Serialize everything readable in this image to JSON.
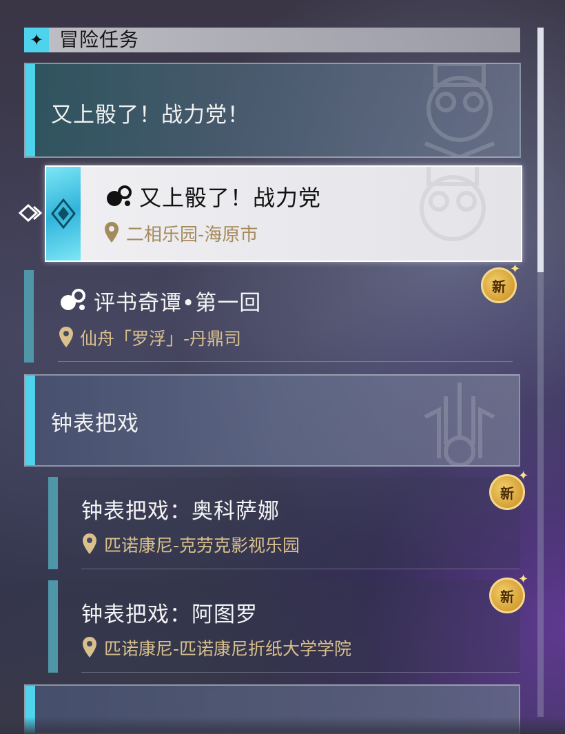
{
  "header": {
    "title": "冒险任务",
    "icon": "diamond-star-icon"
  },
  "categories": [
    {
      "title": "又上骰了！战力党！"
    },
    {
      "title": "钟表把戏"
    },
    {
      "title": ""
    }
  ],
  "quests": [
    {
      "title": "又上骰了！战力党",
      "location": "二相乐园-海原市",
      "selected": true,
      "new": false
    },
    {
      "title": "评书奇谭•第一回",
      "location": "仙舟「罗浮」-丹鼎司",
      "selected": false,
      "new": true
    },
    {
      "title": "钟表把戏：奥科萨娜",
      "location": "匹诺康尼-克劳克影视乐园",
      "selected": false,
      "new": true
    },
    {
      "title": "钟表把戏：阿图罗",
      "location": "匹诺康尼-匹诺康尼折纸大学学院",
      "selected": false,
      "new": true
    }
  ],
  "badge_label": "新",
  "colors": {
    "accent": "#4fd3ec",
    "location_text": "#d9c08c",
    "badge": "#e0a83a"
  }
}
